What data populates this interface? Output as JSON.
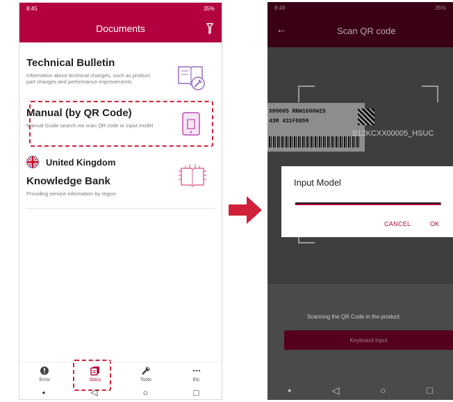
{
  "left": {
    "status": {
      "time": "8:45",
      "right": "35%"
    },
    "header": {
      "title": "Documents"
    },
    "cards": [
      {
        "title": "Technical Bulletin",
        "desc": "Information about technical changes, such as product part changes and performance improvements"
      },
      {
        "title": "Manual (by QR Code)",
        "desc": "Manual Guide search via scan QR code or input model"
      },
      {
        "region": "United Kingdom",
        "title": "Knowledge Bank",
        "desc": "Providing service information by region"
      }
    ],
    "nav": [
      {
        "label": "Error"
      },
      {
        "label": "Docs"
      },
      {
        "label": "Tools"
      },
      {
        "label": "Etc"
      }
    ]
  },
  "right": {
    "status": {
      "time": "8:49",
      "right": "35%"
    },
    "header": {
      "title": "Scan QR code"
    },
    "camera_label": {
      "line1": "X00005 RNW1600W2S",
      "line2": "43M  431F0859",
      "scanned": "B12KCXX00005_HSUC"
    },
    "dialog": {
      "title": "Input Model",
      "input_value": "",
      "cancel": "CANCEL",
      "ok": "OK"
    },
    "scan_message": "Scanning the QR Code in the product.",
    "keyboard_button": "Keyboard Input"
  },
  "colors": {
    "brand": "#b3003f",
    "highlight": "#d0203a"
  }
}
